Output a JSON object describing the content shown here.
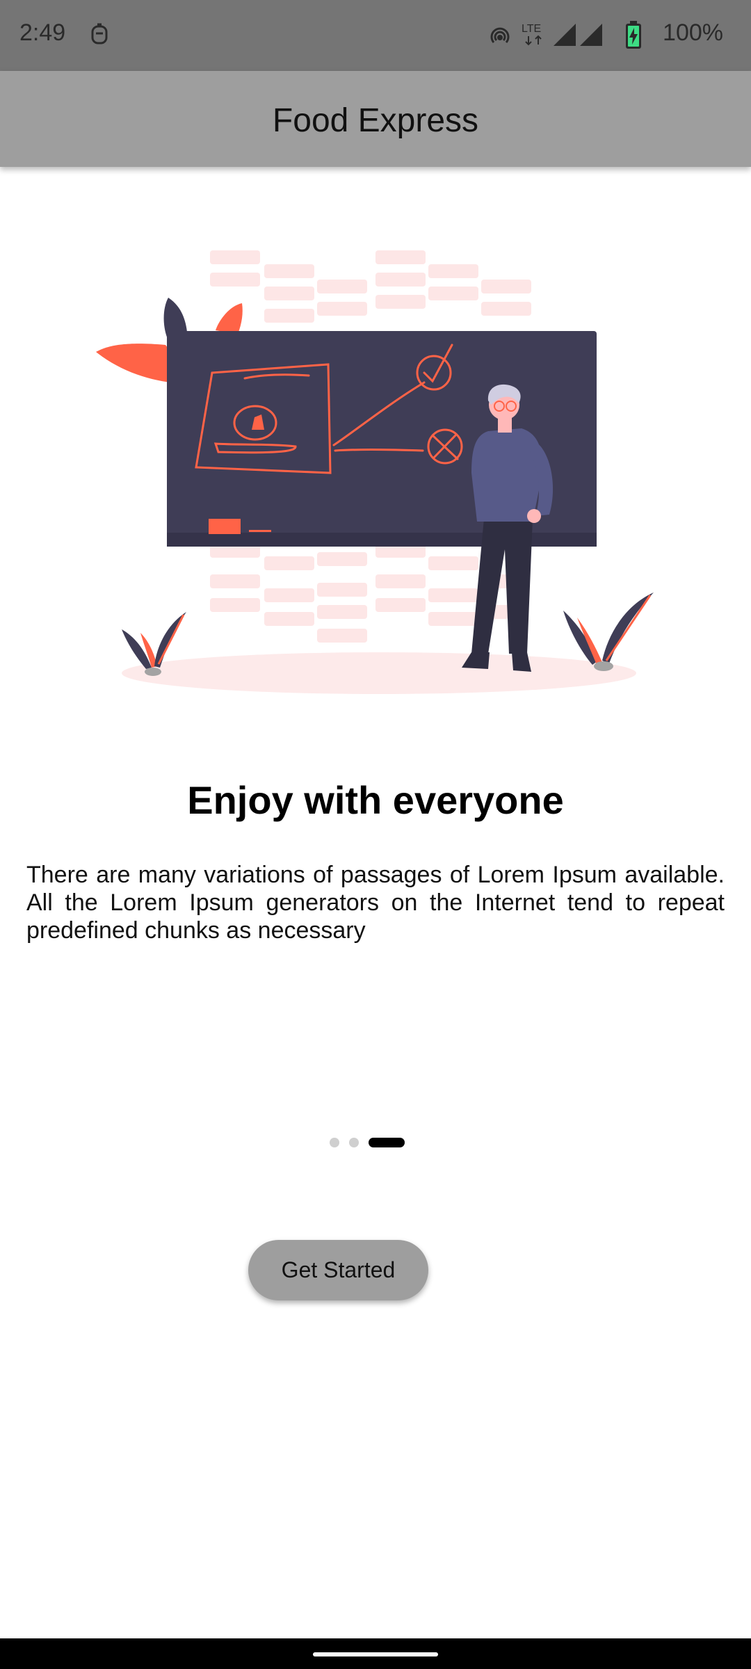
{
  "status_bar": {
    "time": "2:49",
    "network_label": "LTE",
    "battery": "100%",
    "icons": [
      "assistant-icon",
      "hotspot-icon",
      "lte-icon",
      "signal-icon",
      "signal-icon",
      "battery-charging-icon"
    ]
  },
  "app_bar": {
    "title": "Food Express"
  },
  "onboarding": {
    "illustration": "teacher-at-chalkboard-illustration",
    "heading": "Enjoy with everyone",
    "body": "There are many variations of passages of Lorem Ipsum available. All the Lorem Ipsum generators on the Internet tend to repeat predefined chunks as necessary",
    "page_count": 3,
    "current_page": 3
  },
  "actions": {
    "get_started_label": "Get Started"
  },
  "colors": {
    "status_bar": "#757575",
    "app_bar": "#9e9e9e",
    "accent": "#ff6347",
    "board": "#3f3d56",
    "button": "#9e9e9e"
  }
}
